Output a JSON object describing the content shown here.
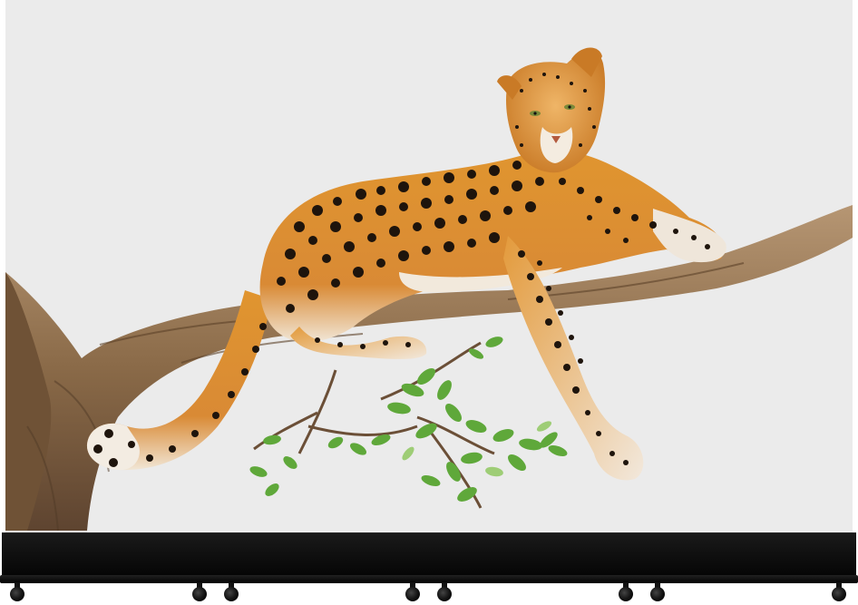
{
  "scene": {
    "subject": "leopard-icon",
    "colors": {
      "panel_background": "#ebebeb",
      "base": "#0a0a0a",
      "leopard_coat": "#d9892f",
      "leopard_spots": "#1e140c",
      "branch": "#8a6a48",
      "leaves": "#5fa83a"
    }
  }
}
